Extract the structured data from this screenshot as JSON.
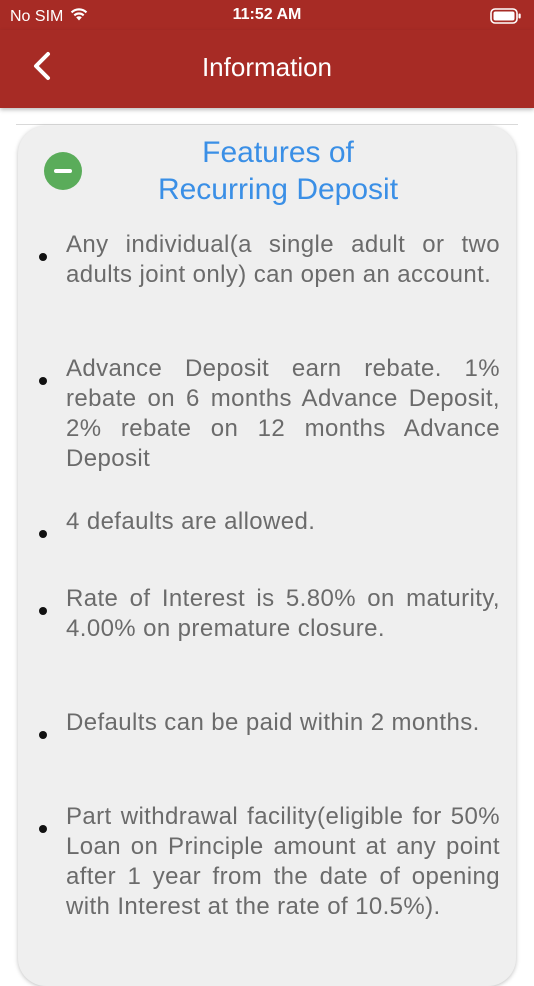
{
  "status_bar": {
    "carrier": "No SIM",
    "time": "11:52 AM"
  },
  "nav": {
    "title": "Information"
  },
  "card": {
    "title_line1": "Features of",
    "title_line2": "Recurring Deposit",
    "items": [
      "Any individual(a single adult or two adults joint only) can open an account.",
      "Advance Deposit earn rebate. 1% rebate on 6 months Advance Deposit, 2% rebate on 12 months Advance Deposit",
      "4 defaults are allowed.",
      "Rate of Interest is 5.80% on maturity, 4.00% on premature closure.",
      "Defaults can be paid within 2 months.",
      "Part withdrawal facility(eligible for 50% Loan on Principle amount at any point after 1 year from the date of opening with Interest at the rate of 10.5%)."
    ]
  },
  "colors": {
    "header_bg": "#a72b25",
    "title_blue": "#3a8fe6",
    "collapse_green": "#5aac5a",
    "card_bg": "#efefef"
  },
  "icons": {
    "back": "chevron-left-icon",
    "collapse": "minus-circle-icon",
    "wifi": "wifi-icon",
    "battery": "battery-icon"
  }
}
